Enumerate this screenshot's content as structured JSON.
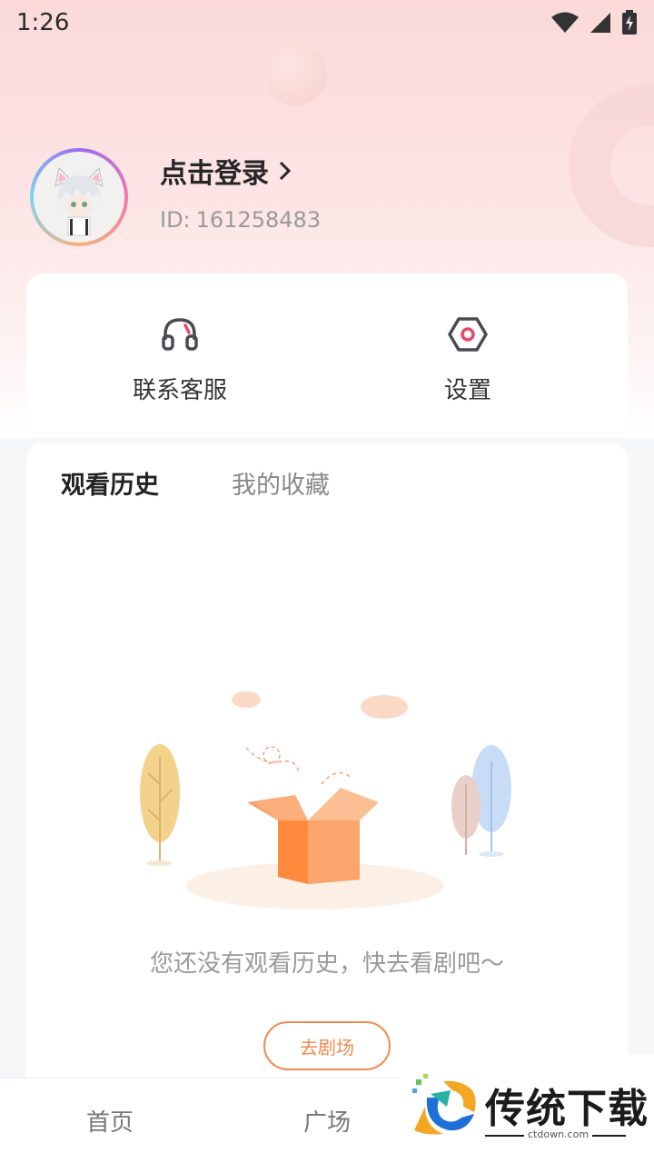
{
  "status_bar": {
    "time": "1:26"
  },
  "profile": {
    "login_label": "点击登录",
    "id_label": "ID:",
    "id_value": "161258483"
  },
  "quick_actions": [
    {
      "label": "联系客服",
      "icon": "headset-icon"
    },
    {
      "label": "设置",
      "icon": "hexagon-settings-icon"
    }
  ],
  "tabs": [
    {
      "label": "观看历史",
      "active": true
    },
    {
      "label": "我的收藏",
      "active": false
    }
  ],
  "empty_state": {
    "message": "您还没有观看历史，快去看剧吧～",
    "button_label": "去剧场"
  },
  "bottom_nav": [
    {
      "label": "首页"
    },
    {
      "label": "广场"
    }
  ],
  "watermark": {
    "title": "传统下载",
    "subtitle": "ctdown.com"
  },
  "colors": {
    "accent": "#f08a4e",
    "header_pink": "#fbd9d9",
    "ring": "#e84a6a"
  }
}
